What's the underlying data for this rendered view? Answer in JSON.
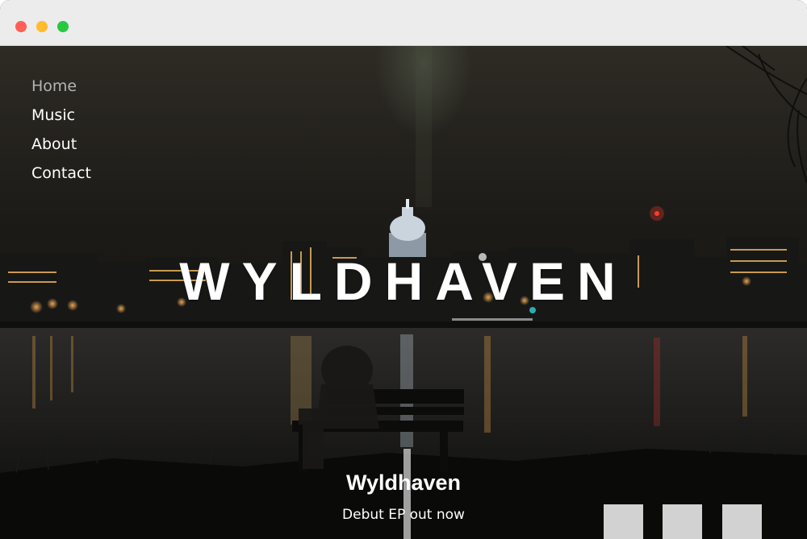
{
  "window": {
    "controls": [
      "close",
      "minimize",
      "maximize"
    ]
  },
  "nav": {
    "items": [
      {
        "label": "Home",
        "active": true
      },
      {
        "label": "Music",
        "active": false
      },
      {
        "label": "About",
        "active": false
      },
      {
        "label": "Contact",
        "active": false
      }
    ]
  },
  "hero": {
    "title": "WYLDHAVEN"
  },
  "release": {
    "title": "Wyldhaven",
    "subtitle": "Debut EP out now"
  },
  "colors": {
    "traffic_close": "#ff5f57",
    "traffic_minimize": "#febc2e",
    "traffic_maximize": "#28c840",
    "nav_text": "#ffffff",
    "nav_active_text": "#b4b4b4",
    "thumbnail_fill": "#d2d2d2"
  }
}
